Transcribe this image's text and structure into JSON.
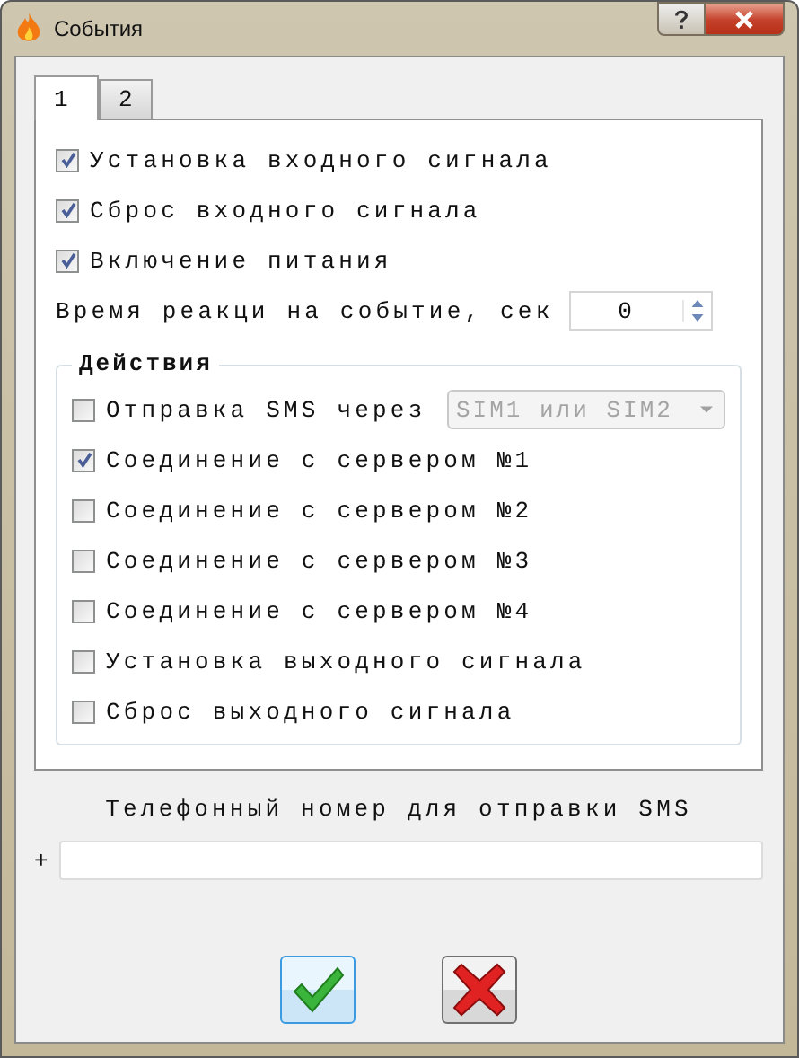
{
  "window": {
    "title": "События"
  },
  "tabs": [
    {
      "label": "1",
      "selected": true
    },
    {
      "label": "2",
      "selected": false
    }
  ],
  "events": [
    {
      "label": "Установка входного сигнала",
      "checked": true
    },
    {
      "label": "Сброс входного сигнала",
      "checked": true
    },
    {
      "label": "Включение питания",
      "checked": true
    }
  ],
  "reaction": {
    "label": "Время реакци на событие, сек",
    "value": "0"
  },
  "actions": {
    "title": "Действия",
    "items": [
      {
        "kind": "combo",
        "label": "Отправка SMS через",
        "checked": false,
        "combo": {
          "value": "SIM1 или SIM2",
          "disabled": true
        }
      },
      {
        "kind": "checkbox",
        "label": "Соединение с сервером №1",
        "checked": true
      },
      {
        "kind": "checkbox",
        "label": "Соединение с сервером №2",
        "checked": false
      },
      {
        "kind": "checkbox",
        "label": "Соединение с сервером №3",
        "checked": false
      },
      {
        "kind": "checkbox",
        "label": "Соединение с сервером №4",
        "checked": false
      },
      {
        "kind": "checkbox",
        "label": "Установка выходного сигнала",
        "checked": false
      },
      {
        "kind": "checkbox",
        "label": "Сброс выходного сигнала",
        "checked": false
      }
    ]
  },
  "phone": {
    "label": "Телефонный номер для отправки SMS",
    "prefix": "+"
  }
}
